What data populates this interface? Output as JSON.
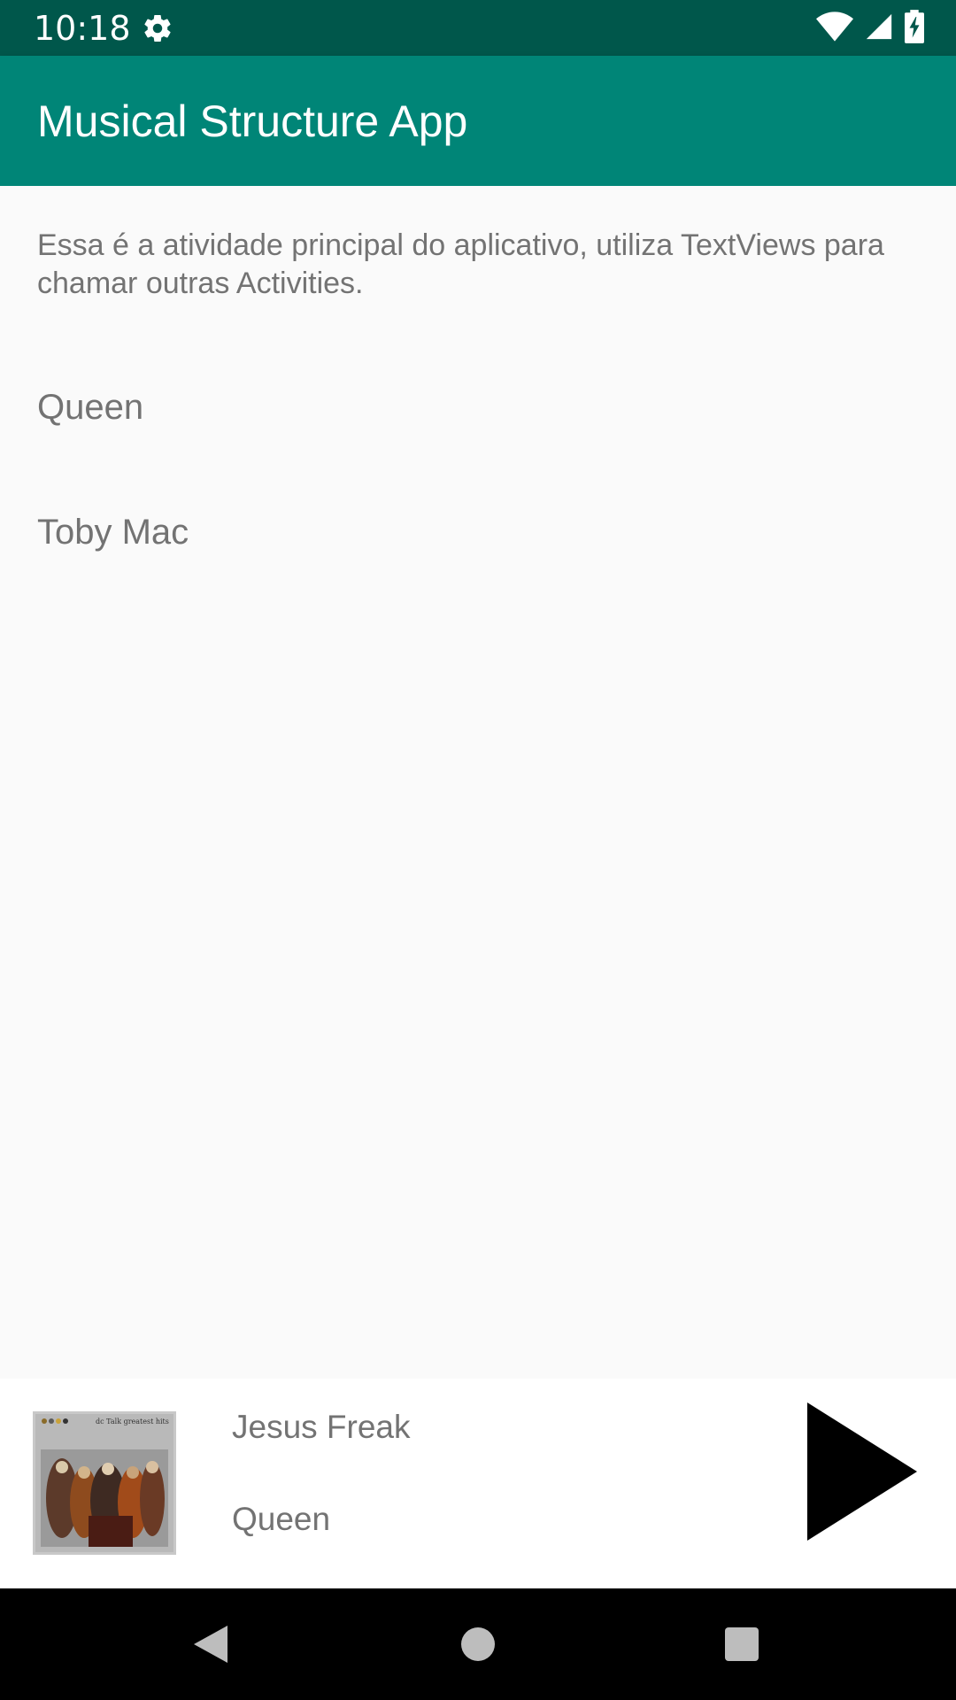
{
  "status_bar": {
    "time": "10:18",
    "icons": [
      "gear-icon",
      "wifi-icon",
      "cell-signal-icon",
      "battery-charging-icon"
    ]
  },
  "app_bar": {
    "title": "Musical Structure App",
    "color": "#008577"
  },
  "main": {
    "intro_text": "Essa é a atividade principal do aplicativo, utiliza TextViews para chamar outras Activities.",
    "artists": [
      {
        "label": "Queen"
      },
      {
        "label": "Toby Mac"
      }
    ]
  },
  "player": {
    "song_title": "Jesus Freak",
    "artist": "Queen",
    "album_art_caption": "dc Talk greatest hits",
    "play_icon": "play-icon"
  },
  "nav_bar": {
    "icons": [
      "back-icon",
      "home-icon",
      "recents-icon"
    ]
  },
  "colors": {
    "status_bar": "#00574b",
    "app_bar": "#008577",
    "text_secondary": "#737373",
    "background": "#fafafa"
  }
}
